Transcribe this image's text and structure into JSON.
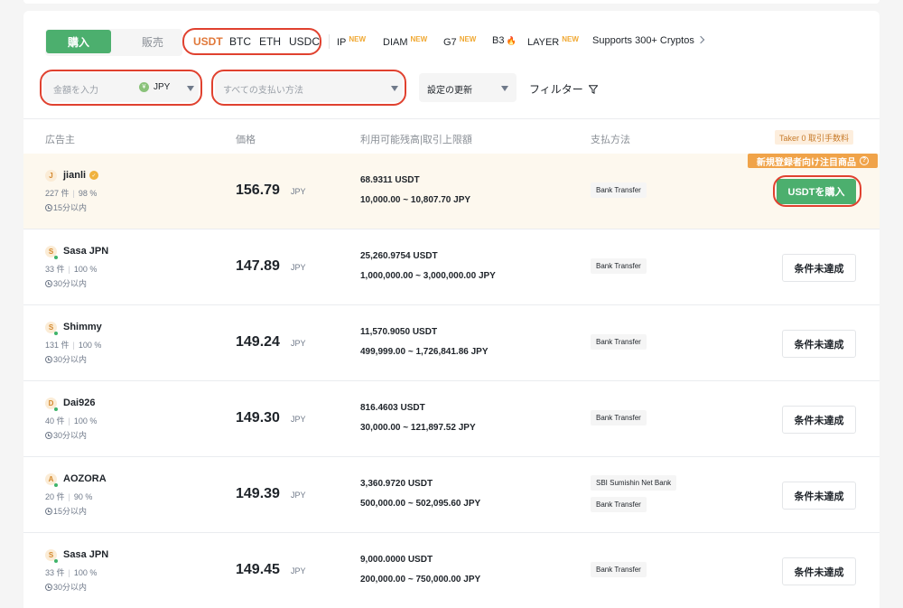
{
  "tabs": {
    "buy": "購入",
    "sell": "販売"
  },
  "coins": [
    {
      "label": "USDT",
      "active": true
    },
    {
      "label": "BTC",
      "active": false
    },
    {
      "label": "ETH",
      "active": false
    },
    {
      "label": "USDC",
      "active": false
    }
  ],
  "extra_coins": [
    {
      "label": "IP",
      "badge": "NEW"
    },
    {
      "label": "DIAM",
      "badge": "NEW"
    },
    {
      "label": "G7",
      "badge": "NEW"
    },
    {
      "label": "B3",
      "badge": ""
    },
    {
      "label": "LAYER",
      "badge": "NEW"
    }
  ],
  "supports": "Supports 300+ Cryptos",
  "filters": {
    "amount_placeholder": "金額を入力",
    "currency": "JPY",
    "currency_icon": "yen-icon",
    "payment_placeholder": "すべての支払い方法",
    "settings": "設定の更新",
    "filter": "フィルター"
  },
  "table": {
    "headers": {
      "advertiser": "広告主",
      "price": "価格",
      "available": "利用可能残高|取引上限額",
      "payment": "支払方法"
    },
    "taker_fee": "Taker 0 取引手数料",
    "promo": "新規登録者向け注目商品",
    "buy_button": "USDTを購入",
    "unmet_button": "条件未達成",
    "price_unit": "JPY",
    "rows": [
      {
        "initial": "J",
        "name": "jianli",
        "verified": true,
        "orders": "227 件",
        "completion": "98 %",
        "time": "15分以内",
        "price": "156.79",
        "available": "68.9311 USDT",
        "limit": "10,000.00 ~ 10,807.70 JPY",
        "payments": [
          "Bank Transfer"
        ],
        "action": "buy"
      },
      {
        "initial": "S",
        "name": "Sasa JPN",
        "verified": false,
        "orders": "33 件",
        "completion": "100 %",
        "time": "30分以内",
        "price": "147.89",
        "available": "25,260.9754 USDT",
        "limit": "1,000,000.00 ~ 3,000,000.00 JPY",
        "payments": [
          "Bank Transfer"
        ],
        "action": "unmet"
      },
      {
        "initial": "S",
        "name": "Shimmy",
        "verified": false,
        "orders": "131 件",
        "completion": "100 %",
        "time": "30分以内",
        "price": "149.24",
        "available": "11,570.9050 USDT",
        "limit": "499,999.00 ~ 1,726,841.86 JPY",
        "payments": [
          "Bank Transfer"
        ],
        "action": "unmet"
      },
      {
        "initial": "D",
        "name": "Dai926",
        "verified": false,
        "orders": "40 件",
        "completion": "100 %",
        "time": "30分以内",
        "price": "149.30",
        "available": "816.4603 USDT",
        "limit": "30,000.00 ~ 121,897.52 JPY",
        "payments": [
          "Bank Transfer"
        ],
        "action": "unmet"
      },
      {
        "initial": "A",
        "name": "AOZORA",
        "verified": false,
        "orders": "20 件",
        "completion": "90 %",
        "time": "15分以内",
        "price": "149.39",
        "available": "3,360.9720 USDT",
        "limit": "500,000.00 ~ 502,095.60 JPY",
        "payments": [
          "SBI Sumishin Net Bank",
          "Bank Transfer"
        ],
        "action": "unmet"
      },
      {
        "initial": "S",
        "name": "Sasa JPN",
        "verified": false,
        "orders": "33 件",
        "completion": "100 %",
        "time": "30分以内",
        "price": "149.45",
        "available": "9,000.0000 USDT",
        "limit": "200,000.00 ~ 750,000.00 JPY",
        "payments": [
          "Bank Transfer"
        ],
        "action": "unmet"
      }
    ]
  }
}
